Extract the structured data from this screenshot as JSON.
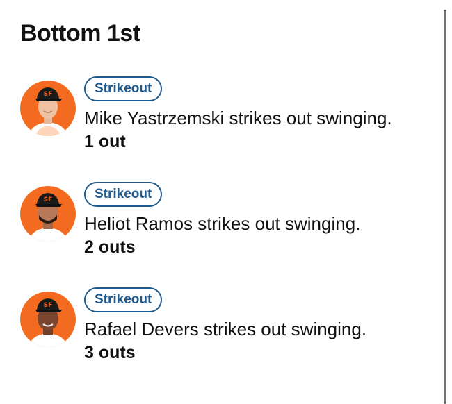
{
  "inning": {
    "title": "Bottom 1st"
  },
  "plays": [
    {
      "badge": "Strikeout",
      "description": "Mike Yastrzemski strikes out swinging.",
      "outs": "1 out",
      "avatar_icon": "player-headshot-icon"
    },
    {
      "badge": "Strikeout",
      "description": "Heliot Ramos strikes out swinging.",
      "outs": "2 outs",
      "avatar_icon": "player-headshot-icon"
    },
    {
      "badge": "Strikeout",
      "description": "Rafael Devers strikes out swinging.",
      "outs": "3 outs",
      "avatar_icon": "player-headshot-icon"
    }
  ],
  "colors": {
    "avatar_background": "#f26b21",
    "badge_accent": "#1f5a8f",
    "cap": "#1a1a1a",
    "text": "#111111"
  }
}
